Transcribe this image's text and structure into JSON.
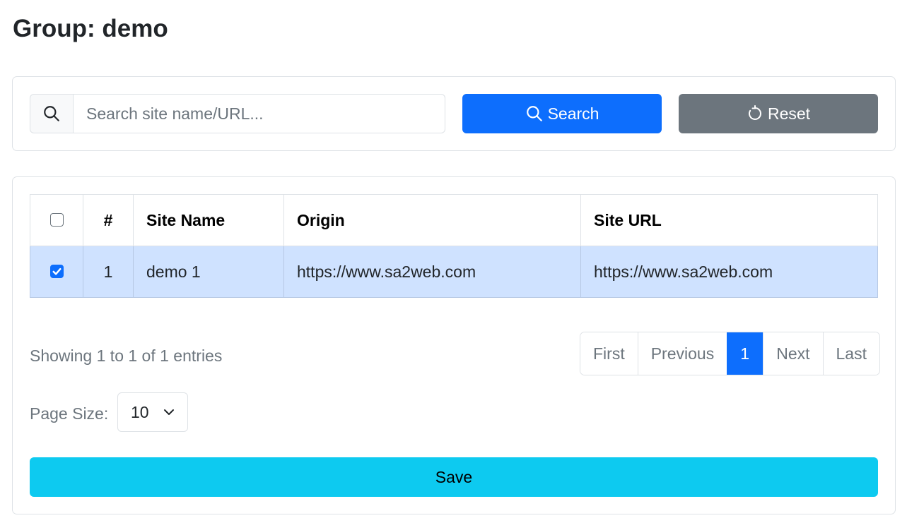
{
  "page": {
    "title": "Group: demo"
  },
  "search": {
    "placeholder": "Search site name/URL...",
    "value": "",
    "search_label": "Search",
    "reset_label": "Reset"
  },
  "table": {
    "columns": [
      "#",
      "Site Name",
      "Origin",
      "Site URL"
    ],
    "rows": [
      {
        "checked": true,
        "num": "1",
        "site_name": "demo 1",
        "origin": "https://www.sa2web.com",
        "site_url": "https://www.sa2web.com"
      }
    ]
  },
  "pagination": {
    "info": "Showing 1 to 1 of 1 entries",
    "first": "First",
    "previous": "Previous",
    "current": "1",
    "next": "Next",
    "last": "Last"
  },
  "page_size": {
    "label": "Page Size:",
    "value": "10"
  },
  "save_label": "Save",
  "colors": {
    "primary": "#0d6efd",
    "secondary": "#6c757d",
    "info": "#0dcaf0",
    "selected_row": "#cfe2ff"
  },
  "icons": {
    "search": "search-icon",
    "reset": "reset-icon",
    "dropdown": "chevron-down-icon",
    "check": "check-icon"
  }
}
